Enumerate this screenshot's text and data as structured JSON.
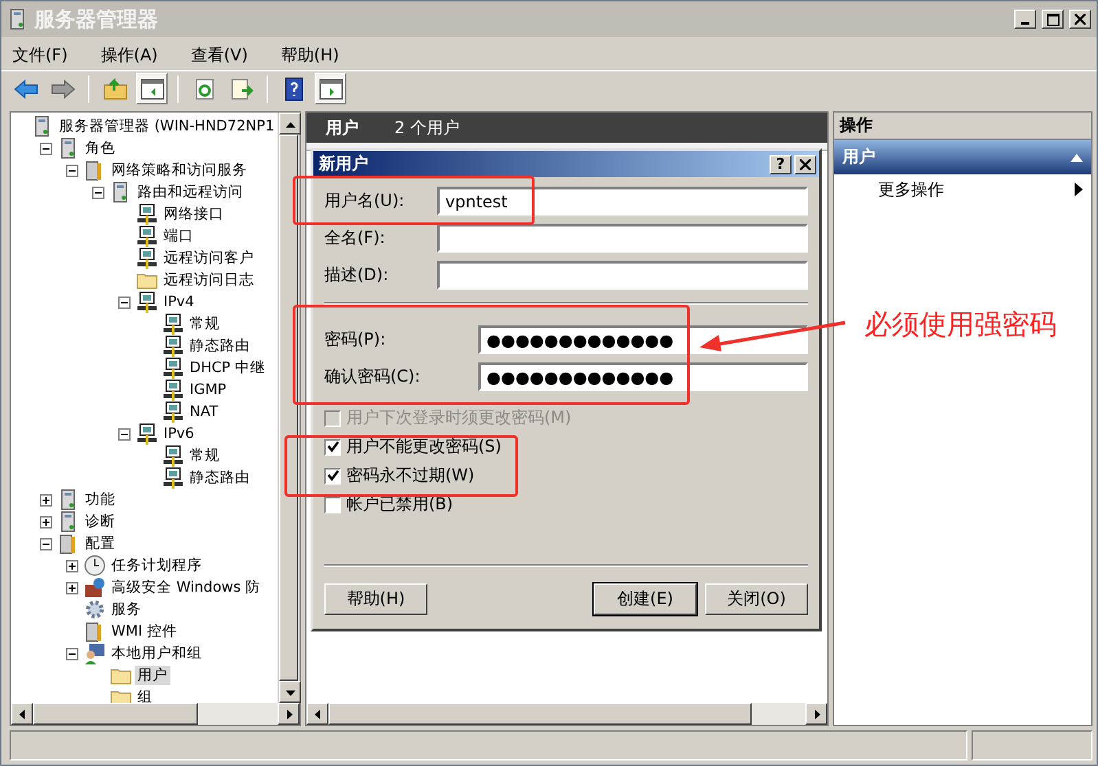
{
  "window": {
    "title": "服务器管理器"
  },
  "menu": [
    "文件(F)",
    "操作(A)",
    "查看(V)",
    "帮助(H)"
  ],
  "toolbar": [
    {
      "kind": "back",
      "pressed": false
    },
    {
      "kind": "forward",
      "pressed": false
    },
    {
      "kind": "sep"
    },
    {
      "kind": "up",
      "pressed": false
    },
    {
      "kind": "pane",
      "pressed": true
    },
    {
      "kind": "sep"
    },
    {
      "kind": "refresh",
      "pressed": false
    },
    {
      "kind": "export",
      "pressed": false
    },
    {
      "kind": "sep"
    },
    {
      "kind": "help",
      "pressed": false
    },
    {
      "kind": "actionpane",
      "pressed": true
    }
  ],
  "tree": [
    {
      "label": "服务器管理器 (WIN-HND72NP1",
      "kind": "server",
      "selected": false,
      "children": [
        {
          "label": "角色",
          "kind": "server",
          "expanded": true,
          "selected": false,
          "children": [
            {
              "label": "网络策略和访问服务",
              "kind": "tools",
              "expanded": true,
              "selected": false,
              "children": [
                {
                  "label": "路由和远程访问",
                  "kind": "server",
                  "expanded": true,
                  "selected": false,
                  "children": [
                    {
                      "label": "网络接口",
                      "kind": "network",
                      "selected": false
                    },
                    {
                      "label": "端口",
                      "kind": "network",
                      "selected": false
                    },
                    {
                      "label": "远程访问客户",
                      "kind": "network",
                      "selected": false
                    },
                    {
                      "label": "远程访问日志",
                      "kind": "folder",
                      "selected": false
                    },
                    {
                      "label": "IPv4",
                      "kind": "network",
                      "expanded": true,
                      "selected": false,
                      "children": [
                        {
                          "label": "常规",
                          "kind": "network",
                          "selected": false
                        },
                        {
                          "label": "静态路由",
                          "kind": "network",
                          "selected": false
                        },
                        {
                          "label": "DHCP 中继",
                          "kind": "network",
                          "selected": false
                        },
                        {
                          "label": "IGMP",
                          "kind": "network",
                          "selected": false
                        },
                        {
                          "label": "NAT",
                          "kind": "network",
                          "selected": false
                        }
                      ]
                    },
                    {
                      "label": "IPv6",
                      "kind": "network",
                      "expanded": true,
                      "selected": false,
                      "children": [
                        {
                          "label": "常规",
                          "kind": "network",
                          "selected": false
                        },
                        {
                          "label": "静态路由",
                          "kind": "network",
                          "selected": false
                        }
                      ]
                    }
                  ]
                }
              ]
            }
          ]
        },
        {
          "label": "功能",
          "kind": "server",
          "expanded": false,
          "selected": false
        },
        {
          "label": "诊断",
          "kind": "server",
          "expanded": false,
          "selected": false
        },
        {
          "label": "配置",
          "kind": "tools",
          "expanded": true,
          "selected": false,
          "children": [
            {
              "label": "任务计划程序",
              "kind": "clock",
              "expanded": false,
              "selected": false
            },
            {
              "label": "高级安全 Windows 防",
              "kind": "firewall",
              "expanded": false,
              "selected": false
            },
            {
              "label": "服务",
              "kind": "gear",
              "selected": false
            },
            {
              "label": "WMI 控件",
              "kind": "tools",
              "selected": false
            },
            {
              "label": "本地用户和组",
              "kind": "users",
              "expanded": true,
              "selected": false,
              "children": [
                {
                  "label": "用户",
                  "kind": "folder",
                  "selected": true
                },
                {
                  "label": "组",
                  "kind": "folder",
                  "selected": false
                }
              ]
            }
          ]
        }
      ]
    }
  ],
  "center": {
    "title": "用户",
    "count": "2 个用户"
  },
  "dialog": {
    "title": "新用户",
    "help_button": "?",
    "fields": [
      {
        "label": "用户名(U):",
        "value": "vpntest",
        "kind": "text"
      },
      {
        "label": "全名(F):",
        "kind": "text"
      },
      {
        "label": "描述(D):",
        "kind": "text"
      },
      {
        "label": "密码(P):",
        "value": "●●●●●●●●●●●●●",
        "kind": "password"
      },
      {
        "label": "确认密码(C):",
        "value": "●●●●●●●●●●●●●",
        "kind": "password"
      }
    ],
    "checkboxes": [
      {
        "label": "用户下次登录时须更改密码(M)",
        "checked": false,
        "disabled": true
      },
      {
        "label": "用户不能更改密码(S)",
        "checked": true,
        "disabled": false
      },
      {
        "label": "密码永不过期(W)",
        "checked": true,
        "disabled": false
      },
      {
        "label": "帐户已禁用(B)",
        "checked": false,
        "disabled": false
      }
    ],
    "buttons": [
      {
        "label": "帮助(H)",
        "default": false
      },
      {
        "label": "创建(E)",
        "default": true
      },
      {
        "label": "关闭(O)",
        "default": false
      }
    ]
  },
  "actions": {
    "title": "操作",
    "section": "用户",
    "items": [
      "更多操作"
    ]
  },
  "annotation": {
    "text": "必须使用强密码"
  }
}
